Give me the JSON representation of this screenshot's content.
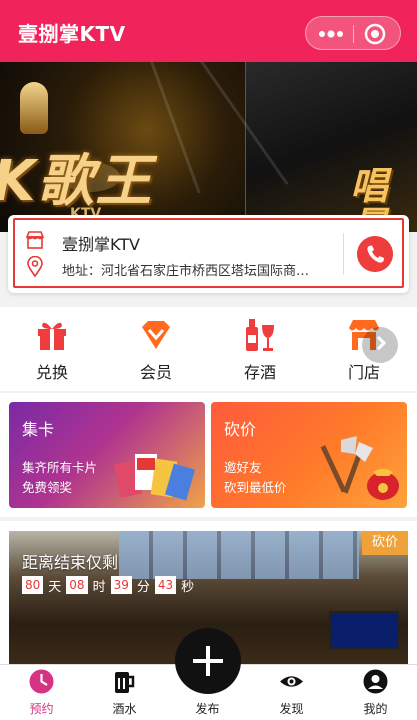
{
  "header": {
    "title": "壹捌掌KTV",
    "more_icon": "more-dots-icon",
    "close_icon": "target-icon"
  },
  "banner": {
    "left_text": "K歌王",
    "left_small": "KTV",
    "right_text": "唱量"
  },
  "store": {
    "name": "壹捌掌KTV",
    "address": "地址：河北省石家庄市桥西区塔坛国际商…",
    "store_icon": "storefront-icon",
    "location_icon": "location-pin-icon",
    "phone_icon": "phone-icon",
    "accent": "#e53935"
  },
  "features": [
    {
      "label": "兑换",
      "icon": "gift-icon"
    },
    {
      "label": "会员",
      "icon": "vip-diamond-icon"
    },
    {
      "label": "存酒",
      "icon": "wine-icon"
    },
    {
      "label": "门店",
      "icon": "shop-icon"
    }
  ],
  "promos": [
    {
      "title": "集卡",
      "line1": "集齐所有卡片",
      "line2": "免费领奖"
    },
    {
      "title": "砍价",
      "line1": "邀好友",
      "line2": "砍到最低价"
    }
  ],
  "bargain": {
    "badge": "砍价",
    "countdown_title": "距离结束仅剩",
    "days": "80",
    "days_unit": "天",
    "hours": "08",
    "hours_unit": "时",
    "minutes": "39",
    "minutes_unit": "分",
    "seconds": "43",
    "seconds_unit": "秒"
  },
  "tabs": [
    {
      "label": "预约",
      "icon": "clock-icon",
      "active": true
    },
    {
      "label": "酒水",
      "icon": "beer-icon",
      "active": false
    },
    {
      "label": "发布",
      "icon": "plus-icon",
      "active": false
    },
    {
      "label": "发现",
      "icon": "eye-icon",
      "active": false
    },
    {
      "label": "我的",
      "icon": "user-icon",
      "active": false
    }
  ],
  "colors": {
    "header": "#f0245a",
    "active_tab": "#d63384",
    "icon_red": "#ef3d3d",
    "icon_orange": "#ff6a1f"
  }
}
